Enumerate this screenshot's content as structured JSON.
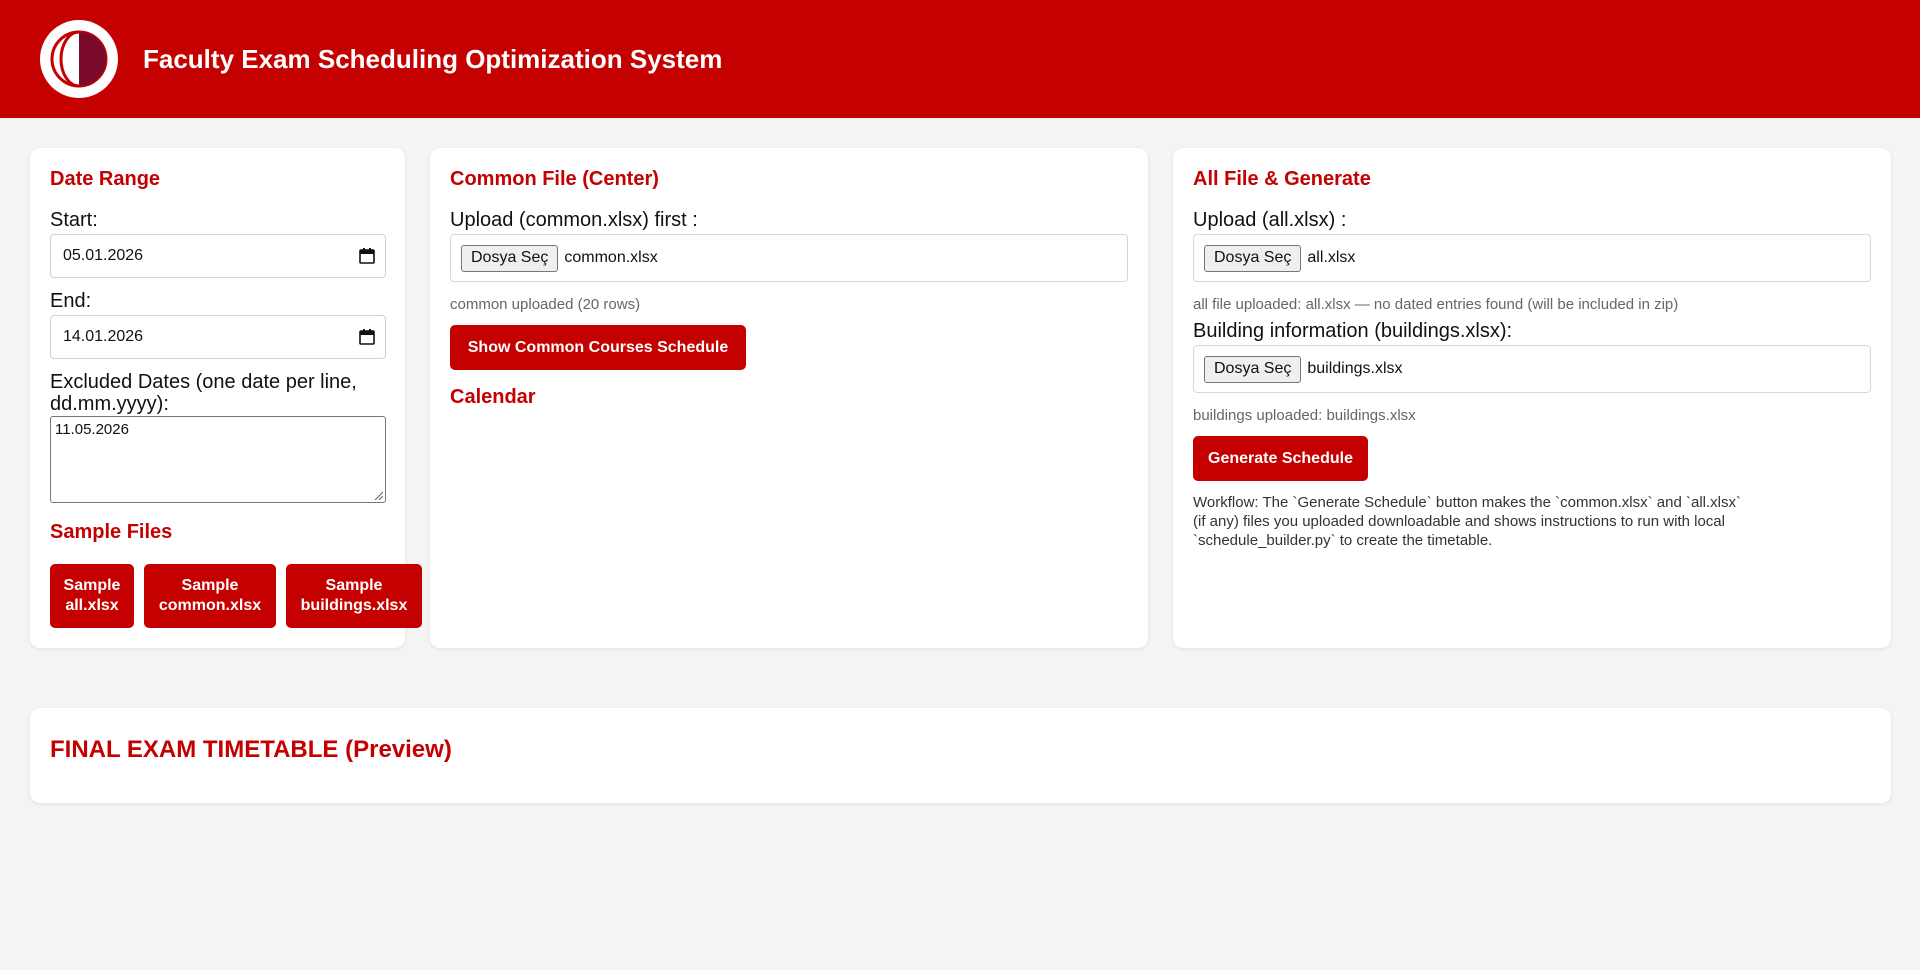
{
  "header": {
    "title": "Faculty Exam Scheduling Optimization System",
    "logo_icon": "university-logo-icon"
  },
  "colors": {
    "brand": "#c40000",
    "background": "#f4f4f4"
  },
  "date_range": {
    "title": "Date Range",
    "start_label": "Start:",
    "start_value": "05.01.2026",
    "end_label": "End:",
    "end_value": "14.01.2026",
    "excluded_label": "Excluded Dates (one date per line, dd.mm.yyyy):",
    "excluded_value": "11.05.2026",
    "sample_title": "Sample Files",
    "sample_buttons": [
      {
        "line1": "Sample",
        "line2": "all.xlsx"
      },
      {
        "line1": "Sample",
        "line2": "common.xlsx"
      },
      {
        "line1": "Sample",
        "line2": "buildings.xlsx"
      }
    ]
  },
  "common": {
    "title": "Common File (Center)",
    "upload_label": "Upload (common.xlsx) first :",
    "file_button": "Dosya Seç",
    "file_name": "common.xlsx",
    "status": "common uploaded (20 rows)",
    "show_button": "Show Common Courses Schedule",
    "calendar_title": "Calendar"
  },
  "all": {
    "title": "All File & Generate",
    "upload_label": "Upload (all.xlsx) :",
    "file_button": "Dosya Seç",
    "file_name": "all.xlsx",
    "status": "all file uploaded: all.xlsx — no dated entries found (will be included in zip)",
    "building_label": "Building information (buildings.xlsx):",
    "building_file_button": "Dosya Seç",
    "building_file_name": "buildings.xlsx",
    "building_status": "buildings uploaded: buildings.xlsx",
    "generate_button": "Generate Schedule",
    "workflow": "Workflow: The `Generate Schedule` button makes the `common.xlsx` and `all.xlsx` (if any) files you uploaded downloadable and shows instructions to run with local `schedule_builder.py` to create the timetable."
  },
  "preview": {
    "title": "FINAL EXAM TIMETABLE (Preview)"
  }
}
